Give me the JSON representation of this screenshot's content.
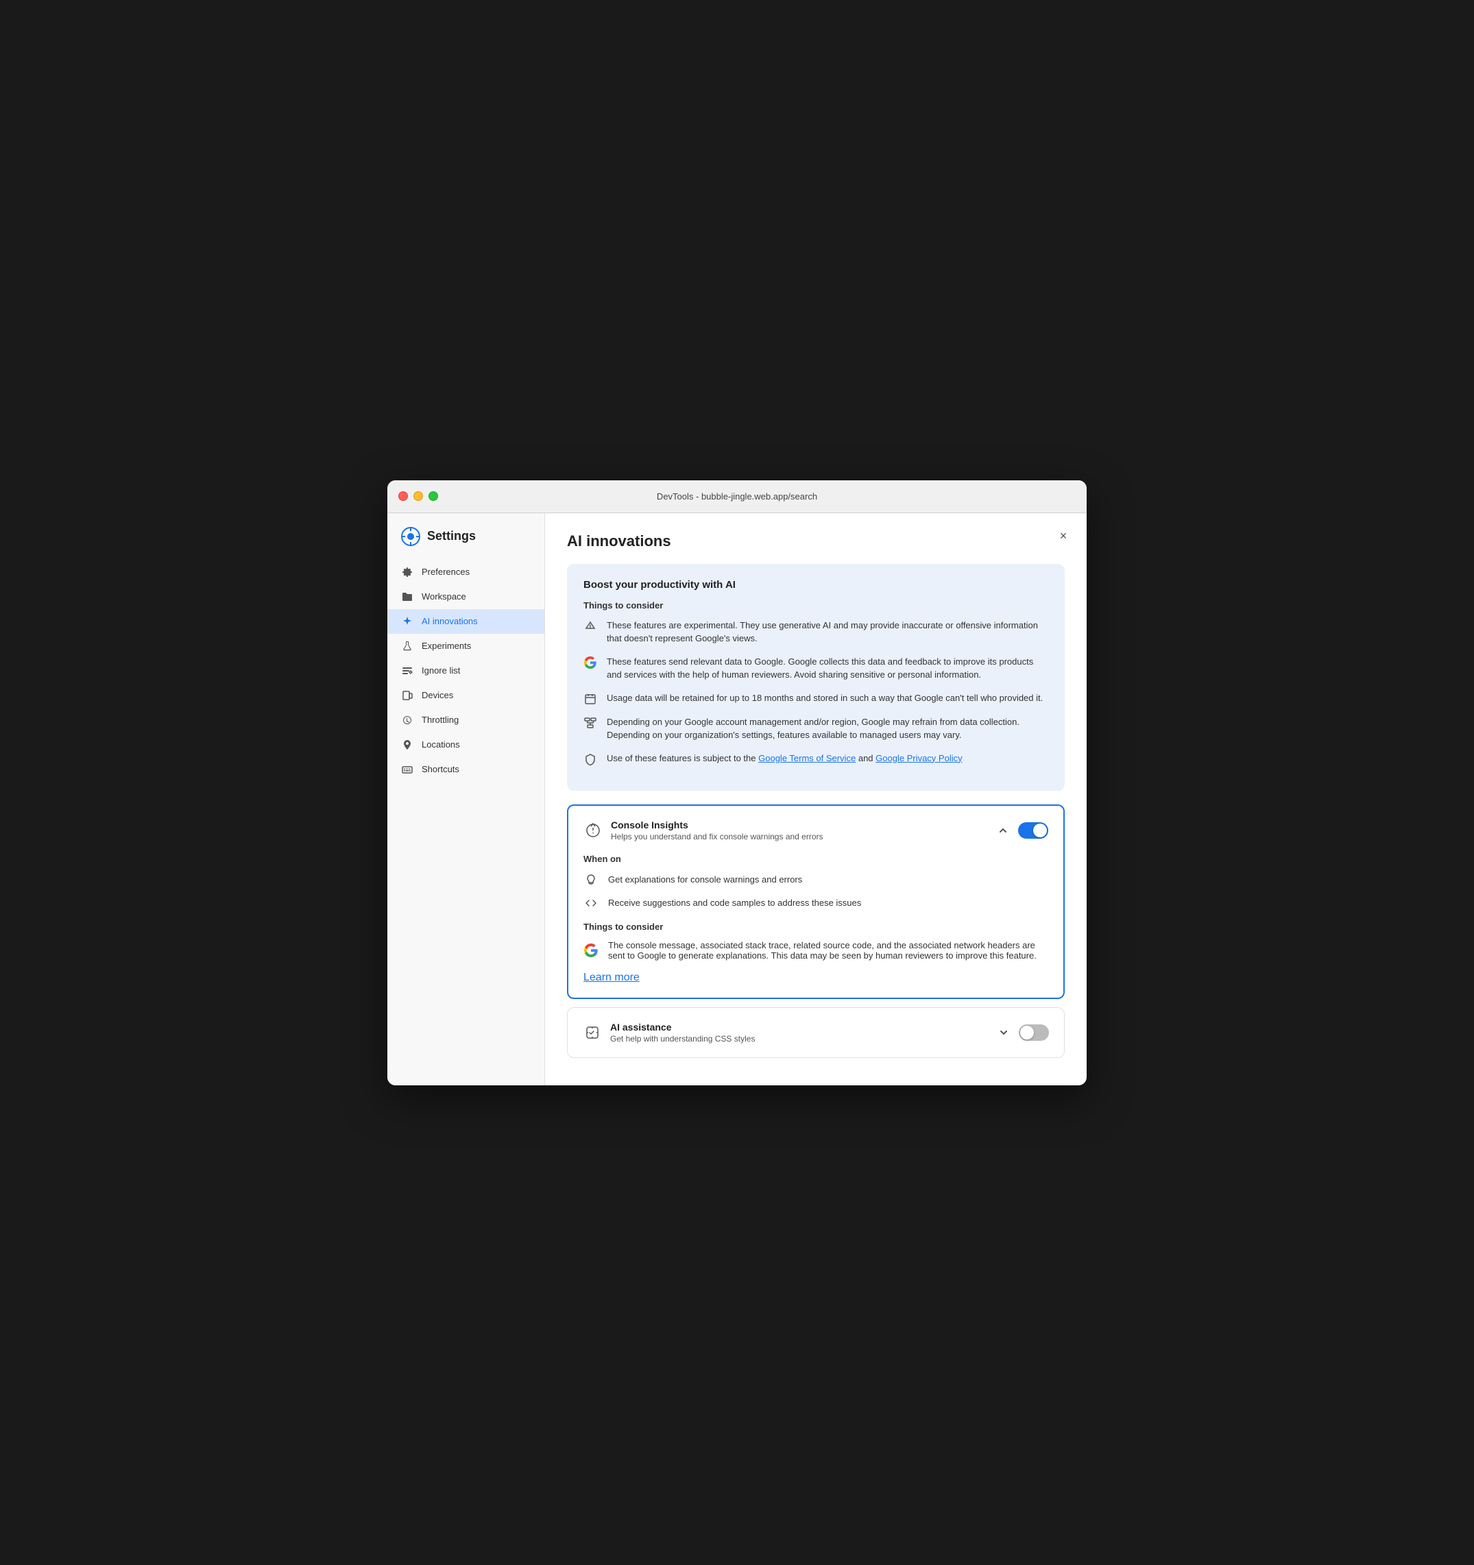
{
  "window": {
    "title": "DevTools - bubble-jingle.web.app/search"
  },
  "sidebar": {
    "heading": "Settings",
    "items": [
      {
        "id": "preferences",
        "label": "Preferences",
        "icon": "gear"
      },
      {
        "id": "workspace",
        "label": "Workspace",
        "icon": "folder"
      },
      {
        "id": "ai-innovations",
        "label": "AI innovations",
        "icon": "sparkle",
        "active": true
      },
      {
        "id": "experiments",
        "label": "Experiments",
        "icon": "flask"
      },
      {
        "id": "ignore-list",
        "label": "Ignore list",
        "icon": "ignore"
      },
      {
        "id": "devices",
        "label": "Devices",
        "icon": "device"
      },
      {
        "id": "throttling",
        "label": "Throttling",
        "icon": "throttle"
      },
      {
        "id": "locations",
        "label": "Locations",
        "icon": "location"
      },
      {
        "id": "shortcuts",
        "label": "Shortcuts",
        "icon": "keyboard"
      }
    ]
  },
  "main": {
    "title": "AI innovations",
    "close_label": "×",
    "info_box": {
      "title": "Boost your productivity with AI",
      "things_to_consider": "Things to consider",
      "items": [
        {
          "text": "These features are experimental. They use generative AI and may provide inaccurate or offensive information that doesn't represent Google's views."
        },
        {
          "text": "These features send relevant data to Google. Google collects this data and feedback to improve its products and services with the help of human reviewers. Avoid sharing sensitive or personal information."
        },
        {
          "text": "Usage data will be retained for up to 18 months and stored in such a way that Google can't tell who provided it."
        },
        {
          "text": "Depending on your Google account management and/or region, Google may refrain from data collection. Depending on your organization's settings, features available to managed users may vary."
        },
        {
          "text_before_link": "Use of these features is subject to the ",
          "link1": "Google Terms of Service",
          "text_between": " and ",
          "link2": "Google Privacy Policy"
        }
      ]
    },
    "console_insights": {
      "title": "Console Insights",
      "description": "Helps you understand and fix console warnings and errors",
      "enabled": true,
      "expanded": true,
      "when_on_title": "When on",
      "when_on_items": [
        {
          "text": "Get explanations for console warnings and errors"
        },
        {
          "text": "Receive suggestions and code samples to address these issues"
        }
      ],
      "things_title": "Things to consider",
      "things_items": [
        {
          "text": "The console message, associated stack trace, related source code, and the associated network headers are sent to Google to generate explanations. This data may be seen by human reviewers to improve this feature."
        }
      ],
      "learn_more": "Learn more"
    },
    "ai_assistance": {
      "title": "AI assistance",
      "description": "Get help with understanding CSS styles",
      "enabled": false,
      "expanded": false
    }
  }
}
